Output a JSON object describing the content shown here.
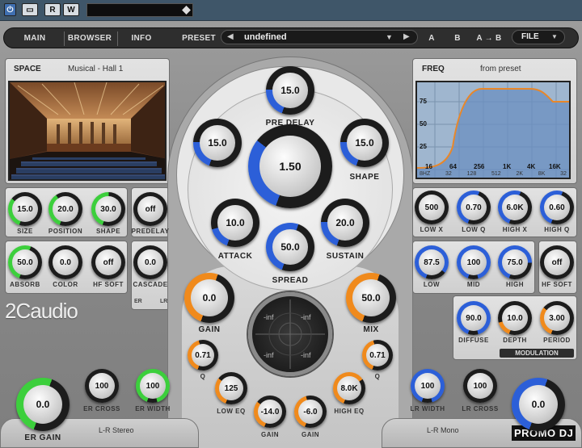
{
  "host": {
    "power_label": "⏻",
    "compare_label": "▭",
    "read_label": "R",
    "write_label": "W"
  },
  "nav": {
    "main": "MAIN",
    "browser": "BROWSER",
    "info": "INFO",
    "preset_label": "PRESET",
    "preset_value": "undefined",
    "a": "A",
    "b": "B",
    "a_to_b": "A → B",
    "file": "FILE"
  },
  "space": {
    "title": "SPACE",
    "preset": "Musical - Hall 1"
  },
  "freq": {
    "title": "FREQ",
    "source": "from preset",
    "yticks": [
      "75",
      "50",
      "25"
    ],
    "xticks": [
      "16",
      "64",
      "256",
      "1K",
      "4K",
      "16K"
    ],
    "xticks2": [
      "8HZ",
      "32",
      "128",
      "512",
      "2K",
      "8K",
      "32"
    ]
  },
  "left_knobs": {
    "size": {
      "value": "15.0",
      "label": "SIZE"
    },
    "position": {
      "value": "20.0",
      "label": "POSITION"
    },
    "shape": {
      "value": "30.0",
      "label": "SHAPE"
    },
    "predelay": {
      "value": "off",
      "label": "PREDELAY"
    },
    "absorb": {
      "value": "50.0",
      "label": "ABSORB"
    },
    "color": {
      "value": "0.0",
      "label": "COLOR"
    },
    "hf_soft": {
      "value": "off",
      "label": "HF SOFT"
    },
    "cascade": {
      "value": "0.0",
      "label": "CASCADE"
    },
    "er": "ER",
    "lr": "LR"
  },
  "center": {
    "pre_delay": {
      "value": "15.0",
      "label": "PRE DELAY"
    },
    "left": {
      "value": "15.0"
    },
    "shape": {
      "value": "15.0",
      "label": "SHAPE"
    },
    "main": {
      "value": "1.50"
    },
    "attack": {
      "value": "10.0",
      "label": "ATTACK"
    },
    "sustain": {
      "value": "20.0",
      "label": "SUSTAIN"
    },
    "spread": {
      "value": "50.0",
      "label": "SPREAD"
    },
    "gain": {
      "value": "0.0",
      "label": "GAIN"
    },
    "mix": {
      "value": "50.0",
      "label": "MIX"
    },
    "q_left": {
      "value": "0.71",
      "label": "Q"
    },
    "q_right": {
      "value": "0.71",
      "label": "Q"
    },
    "low_eq": {
      "value": "125",
      "label": "LOW EQ"
    },
    "high_eq": {
      "value": "8.0K",
      "label": "HIGH EQ"
    },
    "gain_low": {
      "value": "-14.0",
      "label": "GAIN"
    },
    "gain_high": {
      "value": "-6.0",
      "label": "GAIN"
    },
    "scope": [
      "-inf",
      "-inf",
      "-inf",
      "-inf"
    ]
  },
  "right_knobs": {
    "low_x": {
      "value": "500",
      "label": "LOW X"
    },
    "low_q": {
      "value": "0.70",
      "label": "LOW Q"
    },
    "high_x": {
      "value": "6.0K",
      "label": "HIGH X"
    },
    "high_q": {
      "value": "0.60",
      "label": "HIGH Q"
    },
    "low": {
      "value": "87.5",
      "label": "LOW"
    },
    "mid": {
      "value": "100",
      "label": "MID"
    },
    "high": {
      "value": "75.0",
      "label": "HIGH"
    },
    "hf_soft": {
      "value": "off",
      "label": "HF SOFT"
    },
    "diffuse": {
      "value": "90.0",
      "label": "DIFFUSE"
    },
    "depth": {
      "value": "10.0",
      "label": "DEPTH"
    },
    "period": {
      "value": "3.00",
      "label": "PERIOD"
    },
    "modulation": "MODULATION"
  },
  "bottom": {
    "er_gain": {
      "value": "0.0",
      "label": "ER GAIN"
    },
    "er_cross": {
      "value": "100",
      "label": "ER CROSS"
    },
    "er_width": {
      "value": "100",
      "label": "ER WIDTH"
    },
    "lr_stereo": "L-R Stereo",
    "lr_width": {
      "value": "100",
      "label": "LR WIDTH"
    },
    "lr_cross": {
      "value": "100",
      "label": "LR CROSS"
    },
    "lr_gain": {
      "value": "0.0"
    },
    "lr_mono": "L-R Mono"
  },
  "brand": {
    "logo": "2Caudio",
    "watermark": "PROMO DJ"
  },
  "colors": {
    "green": "#3ccf3c",
    "blue": "#2c5fd8",
    "orange": "#f08a1c"
  }
}
